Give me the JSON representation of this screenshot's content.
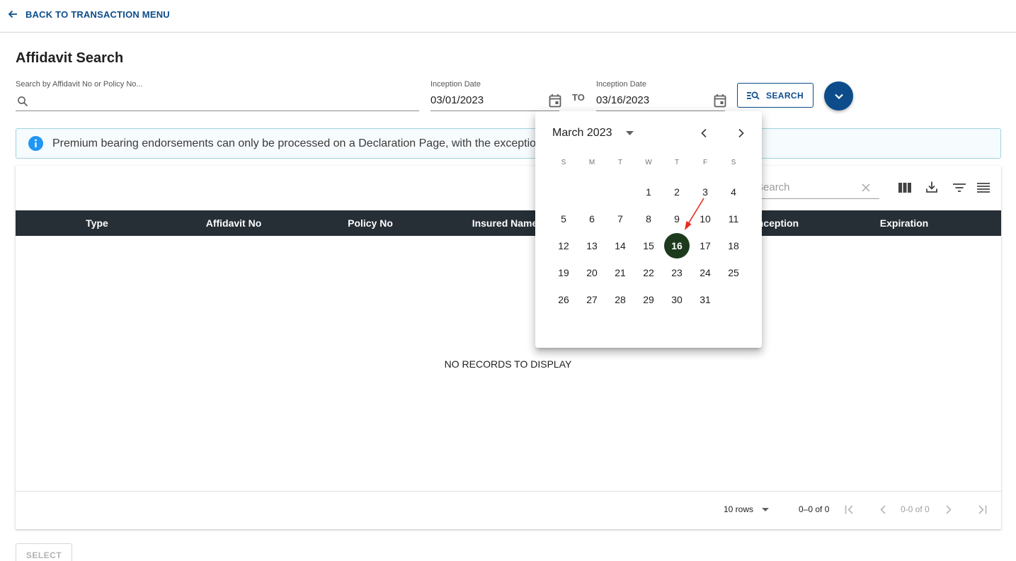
{
  "nav": {
    "back_label": "BACK TO TRANSACTION MENU"
  },
  "page": {
    "title": "Affidavit Search"
  },
  "filters": {
    "search_label": "Search by Affidavit No or Policy No...",
    "search_value": "",
    "from": {
      "label": "Inception Date",
      "value": "03/01/2023"
    },
    "to_label": "TO",
    "to": {
      "label": "Inception Date",
      "value": "03/16/2023"
    },
    "search_button": "SEARCH"
  },
  "banner": {
    "text": "Premium bearing endorsements can only be processed on a Declaration Page, with the exception of"
  },
  "table": {
    "search_placeholder": "Search",
    "columns": [
      "Type",
      "Affidavit No",
      "Policy No",
      "Insured Name",
      "Inception",
      "Expiration"
    ],
    "empty_text": "NO RECORDS TO DISPLAY",
    "rows_per_page": "10 rows",
    "range_text": "0–0 of 0",
    "page_text": "0-0 of 0"
  },
  "footer": {
    "select_label": "SELECT"
  },
  "datepicker": {
    "month_label": "March 2023",
    "weekdays": [
      "S",
      "M",
      "T",
      "W",
      "T",
      "F",
      "S"
    ],
    "first_weekday_index": 3,
    "days_in_month": 31,
    "selected_day": 16
  },
  "colors": {
    "primary": "#0d4c8b",
    "table_header": "#262e36",
    "selected_day": "#1d3a1d",
    "info_icon": "#2196f3",
    "annotation_arrow": "#e8291c"
  }
}
